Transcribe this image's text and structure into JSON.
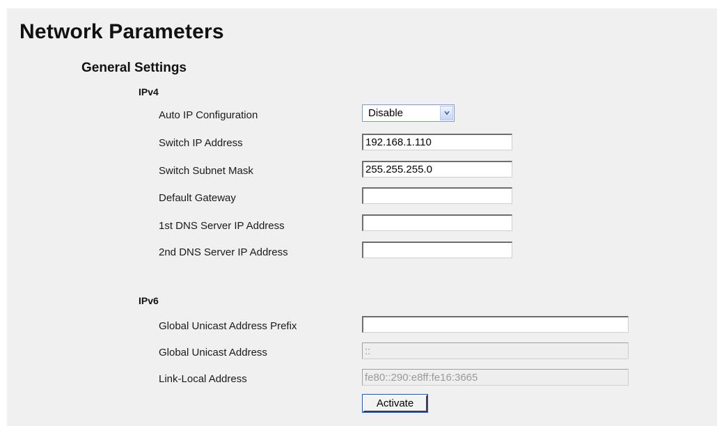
{
  "page": {
    "title": "Network Parameters",
    "subtitle": "General Settings"
  },
  "ipv4": {
    "heading": "IPv4",
    "auto_ip": {
      "label": "Auto IP Configuration",
      "value": "Disable"
    },
    "switch_ip": {
      "label": "Switch IP Address",
      "value": "192.168.1.110"
    },
    "subnet_mask": {
      "label": "Switch Subnet Mask",
      "value": "255.255.255.0"
    },
    "gateway": {
      "label": "Default Gateway",
      "value": ""
    },
    "dns1": {
      "label": "1st DNS Server IP Address",
      "value": ""
    },
    "dns2": {
      "label": "2nd DNS Server IP Address",
      "value": ""
    }
  },
  "ipv6": {
    "heading": "IPv6",
    "unicast_prefix": {
      "label": "Global Unicast Address Prefix",
      "value": ""
    },
    "unicast_address": {
      "label": "Global Unicast Address",
      "value": "::"
    },
    "link_local": {
      "label": "Link-Local Address",
      "value": "fe80::290:e8ff:fe16:3665"
    }
  },
  "actions": {
    "activate_label": "Activate"
  }
}
